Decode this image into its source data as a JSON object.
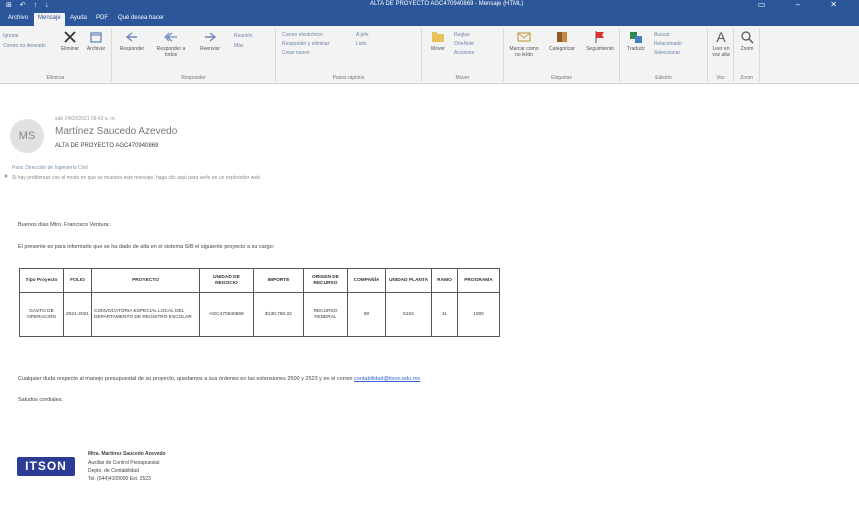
{
  "titlebar": {
    "qat": "⊞ ↶ ↑ ↓",
    "title": "ALTA DE PROYECTO AGC470940869 - Mensaje (HTML)",
    "controls": "▭ – ✕"
  },
  "tabs": [
    {
      "label": "Archivo"
    },
    {
      "label": "Mensaje"
    },
    {
      "label": "Ayuda"
    },
    {
      "label": "PDF"
    },
    {
      "label": "Qué desea hacer"
    }
  ],
  "ribbon": {
    "ignore": "Ignorar",
    "junk": "Correo no deseado",
    "delete": "Eliminar",
    "archive": "Archivar",
    "reply": "Responder",
    "reply_all": "Responder a todos",
    "forward": "Reenviar",
    "more": "Más",
    "quick1": "Reunión",
    "quick2": "Correo electrónico",
    "quick3": "Responder y eliminar",
    "quick4": "A jefe",
    "quick5": "Listo",
    "quick6": "Crear nuevo",
    "move": "Mover",
    "rules": "Reglas",
    "onenote": "OneNote",
    "actions": "Acciones",
    "mark_unread": "Marcar como no leído",
    "categorize": "Categorizar",
    "followup": "Seguimiento",
    "translate": "Traducir",
    "find": "Buscar",
    "related": "Relacionado",
    "select": "Seleccionar",
    "read_aloud": "Leer en voz alta",
    "zoom": "Zoom",
    "group_delete": "Eliminar",
    "group_respond": "Responder",
    "group_quick": "Pasos rápidos",
    "group_move": "Mover",
    "group_tags": "Etiquetas",
    "group_edit": "Edición",
    "group_voice": "Voz",
    "group_zoom": "Zoom"
  },
  "header": {
    "date": "sáb 24/03/2021 09:42 a. m.",
    "avatar": "MS",
    "sender": "Martínez Saucedo Azevedo",
    "subject": "ALTA DE PROYECTO AGC470940869",
    "to": "Para: Dirección de Ingeniería Civil",
    "note": "Si hay problemas con el modo en que se muestra este mensaje, haga clic aquí para verlo en un explorador web."
  },
  "body": {
    "greeting": "Buenos días Mtro. Francisco Ventura:",
    "intro": "El presente es para informarle que se ha dado de alta en el sistema SIB el siguiente proyecto a su cargo:",
    "closing_line": "Cualquier duda respecto al manejo presupuestal de su proyecto, quedamos a sus órdenes en las extensiones 2500 y 2523 y en el correo",
    "email": "contabilidad@itson.edu.mx",
    "regards": "Saludos cordiales."
  },
  "table": {
    "headers": [
      "Tipo Proyecto",
      "FOLIO",
      "PROYECTO",
      "UNIDAD DE NEGOCIO",
      "IMPORTE",
      "ORIGEN DE RECURSO",
      "COMPAÑÍA",
      "UNIDAD PLANTA",
      "RAMO",
      "PROGRAMA"
    ],
    "rows": [
      [
        "GASTO DE OPERACIÓN",
        "2021-2021",
        "CONVOCATORIA ESPECIAL LOCAL DEL DEPARTAMENTO DE REGISTRO ESCOLAR",
        "AGC470940869",
        "$130,780.22",
        "RECURSO FEDERAL",
        "90",
        "5102",
        "11",
        "1000"
      ]
    ]
  },
  "signature": {
    "logo": "ITSON",
    "name": "Mtra. Martínez Saucedo Azevedo",
    "role": "Auxiliar de Control Presupuestal",
    "dept": "Depto. de Contabilidad",
    "phone": "Tel. (644)4109000 Ext. 2523"
  }
}
